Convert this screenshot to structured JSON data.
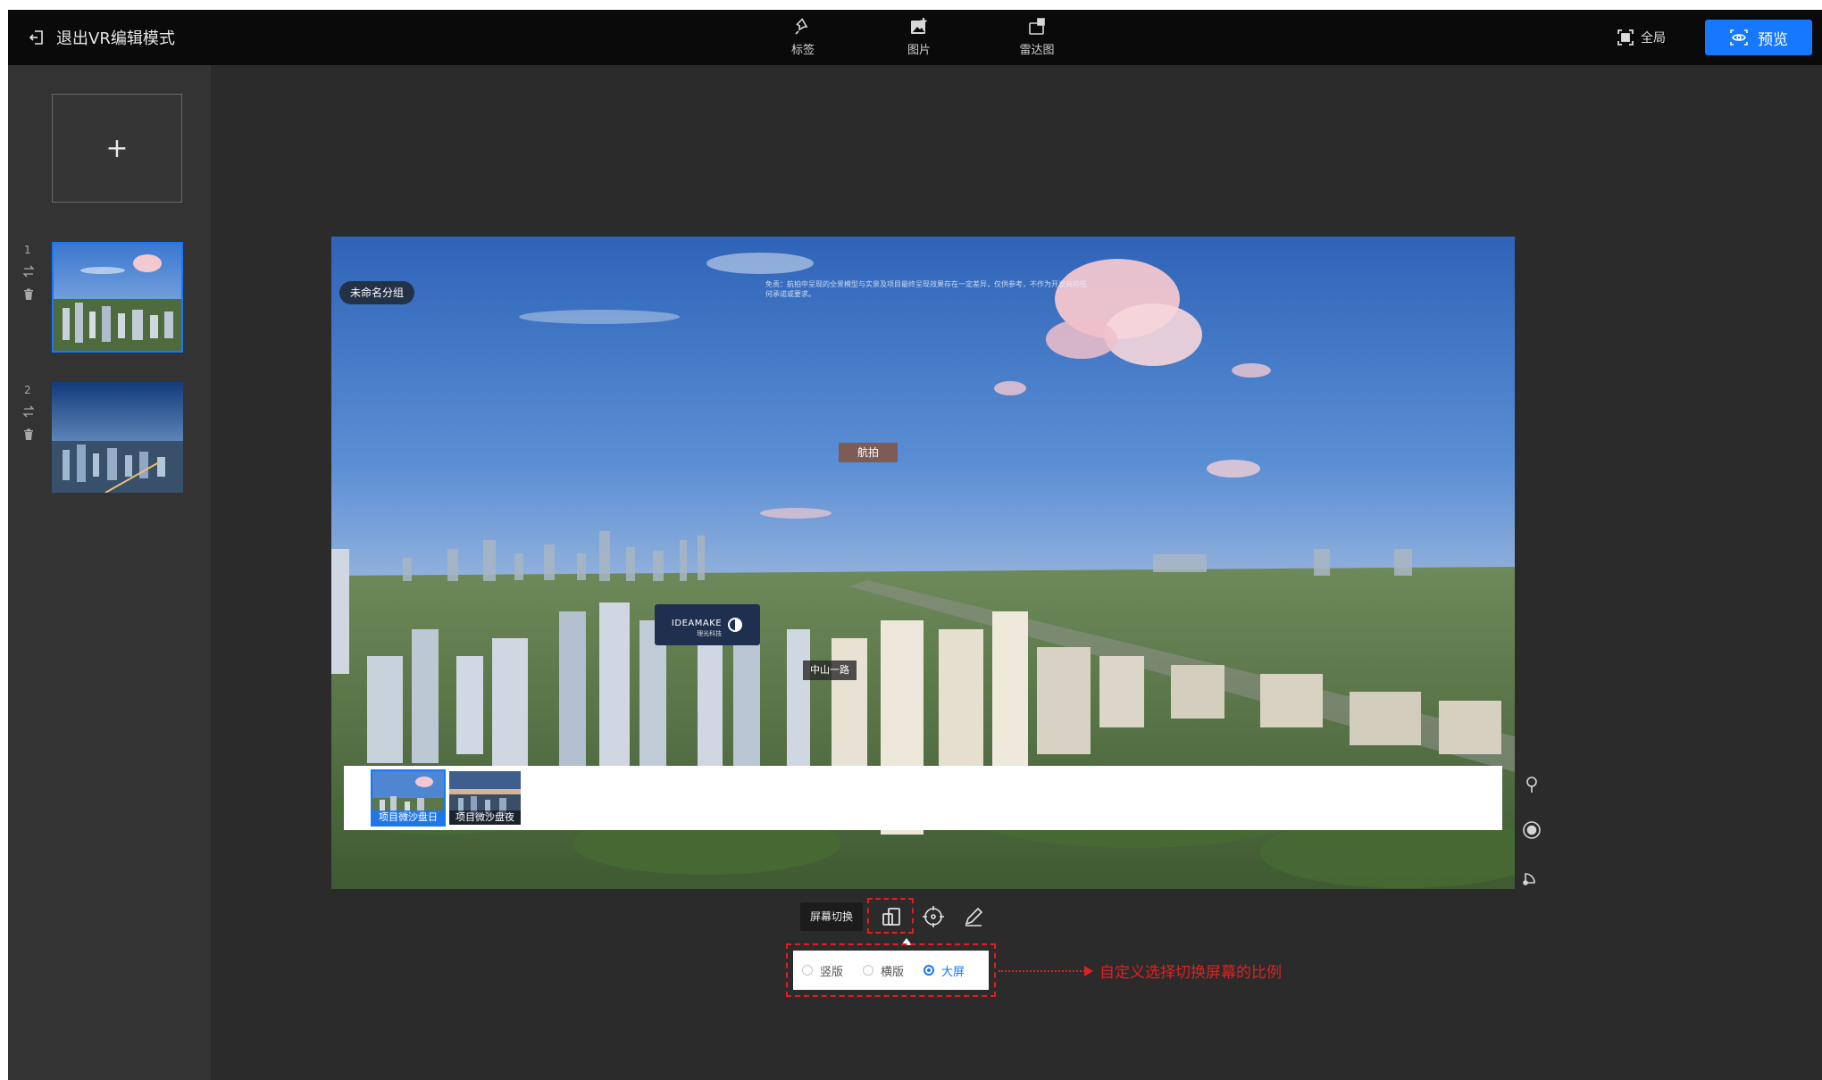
{
  "topbar": {
    "exit_label": "退出VR编辑模式",
    "tools": [
      {
        "label": "标签",
        "icon": "pin-icon"
      },
      {
        "label": "图片",
        "icon": "image-add-icon"
      },
      {
        "label": "雷达图",
        "icon": "radar-map-icon"
      }
    ],
    "fullscreen_label": "全局",
    "preview_label": "预览",
    "accent_color": "#1677ff"
  },
  "sidebar": {
    "add_symbol": "+",
    "scenes": [
      {
        "number": "1",
        "active": true
      },
      {
        "number": "2",
        "active": false
      }
    ]
  },
  "panorama": {
    "group_label": "未命名分组",
    "disclaimer": "免责：航拍中呈现的全景模型与实景及项目最终呈现效果存在一定差异，仅供参考，不作为开发商的任何承诺或要求。",
    "hotspot_aerial": "航拍",
    "hotspot_road": "中山一路",
    "logo_text": "IDEAMAKE",
    "logo_sub": "理光科技",
    "strip_items": [
      {
        "caption": "项目微沙盘日",
        "active": true
      },
      {
        "caption": "项目微沙盘夜",
        "active": false
      }
    ]
  },
  "controls": {
    "screen_switch": "屏幕切换",
    "ratio_options": [
      {
        "label": "竖版",
        "selected": false
      },
      {
        "label": "横版",
        "selected": false
      },
      {
        "label": "大屏",
        "selected": true
      }
    ],
    "annotation": "自定义选择切换屏幕的比例",
    "annotation_color": "#e02020"
  }
}
